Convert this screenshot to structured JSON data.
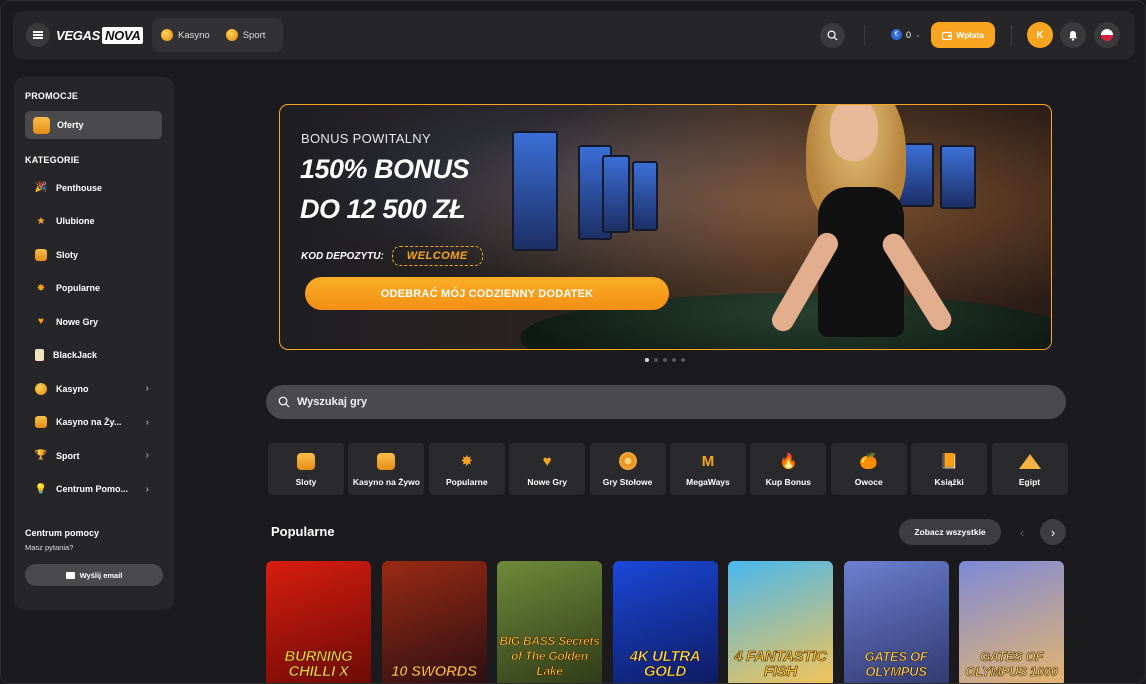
{
  "header": {
    "logo": {
      "part1": "VEGAS",
      "part2": "NOVA"
    },
    "modes": [
      {
        "label": "Kasyno"
      },
      {
        "label": "Sport"
      }
    ],
    "balance": "0",
    "deposit_label": "Wpłata",
    "avatar_letter": "K"
  },
  "sidebar": {
    "promo_heading": "PROMOCJE",
    "offers_label": "Oferty",
    "categories_heading": "KATEGORIE",
    "items": [
      {
        "label": "Penthouse",
        "icon": "party-popper-icon"
      },
      {
        "label": "Ulubione",
        "icon": "star-icon"
      },
      {
        "label": "Sloty",
        "icon": "slot-machine-icon"
      },
      {
        "label": "Popularne",
        "icon": "starburst-icon"
      },
      {
        "label": "Nowe Gry",
        "icon": "heart-icon"
      },
      {
        "label": "BlackJack",
        "icon": "card-icon"
      },
      {
        "label": "Kasyno",
        "icon": "chip-icon",
        "expandable": true
      },
      {
        "label": "Kasyno na Ży...",
        "icon": "live-icon",
        "expandable": true
      },
      {
        "label": "Sport",
        "icon": "trophy-icon",
        "expandable": true
      },
      {
        "label": "Centrum Pomo...",
        "icon": "bulb-icon",
        "expandable": true
      }
    ],
    "help_title": "Centrum pomocy",
    "help_sub": "Masz pytania?",
    "email_label": "Wyślij email"
  },
  "banner": {
    "kicker": "BONUS POWITALNY",
    "title_line1": "150% BONUS",
    "title_line2": "DO 12 500 ZŁ",
    "code_label": "KOD DEPOZYTU:",
    "code_value": "WELCOME",
    "cta": "ODEBRAĆ MÓJ CODZIENNY DODATEK"
  },
  "search": {
    "placeholder": "Wyszukaj gry"
  },
  "categories": [
    {
      "label": "Sloty",
      "icon": "slot-machine-icon"
    },
    {
      "label": "Kasyno na Żywo",
      "icon": "live-icon"
    },
    {
      "label": "Popularne",
      "icon": "starburst-icon"
    },
    {
      "label": "Nowe Gry",
      "icon": "heart-icon"
    },
    {
      "label": "Gry Stołowe",
      "icon": "roulette-icon"
    },
    {
      "label": "MegaWays",
      "icon": "megaways-icon"
    },
    {
      "label": "Kup Bonus",
      "icon": "flame-icon"
    },
    {
      "label": "Owoce",
      "icon": "fruit-icon"
    },
    {
      "label": "Książki",
      "icon": "book-icon"
    },
    {
      "label": "Egipt",
      "icon": "pyramid-icon"
    }
  ],
  "popular": {
    "title": "Popularne",
    "see_all": "Zobacz wszystkie",
    "games": [
      {
        "title": "BURNING CHILLI X",
        "colors": [
          "#d81d10",
          "#6a0a05"
        ]
      },
      {
        "title": "10 SWORDS",
        "colors": [
          "#9a2a14",
          "#2a0f12"
        ]
      },
      {
        "title": "BIG BASS Secrets of The Golden Lake",
        "colors": [
          "#6f8a3a",
          "#2f3a18"
        ]
      },
      {
        "title": "4K ULTRA GOLD",
        "colors": [
          "#1b48d8",
          "#0d1a60"
        ]
      },
      {
        "title": "4 FANTASTIC FISH",
        "colors": [
          "#49b7ee",
          "#f6c454"
        ]
      },
      {
        "title": "GATES OF OLYMPUS",
        "colors": [
          "#6c7fd0",
          "#30396f"
        ]
      },
      {
        "title": "GATES OF OLYMPUS 1000",
        "colors": [
          "#7d89d8",
          "#e6b56c"
        ]
      }
    ]
  }
}
